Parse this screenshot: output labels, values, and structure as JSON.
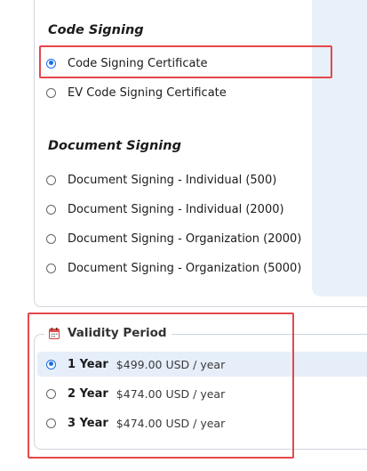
{
  "code_signing": {
    "title": "Code Signing",
    "options": [
      {
        "label": "Code Signing Certificate",
        "checked": true
      },
      {
        "label": "EV Code Signing Certificate",
        "checked": false
      }
    ]
  },
  "document_signing": {
    "title": "Document Signing",
    "options": [
      {
        "label": "Document Signing - Individual (500)",
        "checked": false
      },
      {
        "label": "Document Signing - Individual (2000)",
        "checked": false
      },
      {
        "label": "Document Signing - Organization (2000)",
        "checked": false
      },
      {
        "label": "Document Signing - Organization (5000)",
        "checked": false
      }
    ]
  },
  "validity": {
    "legend": "Validity Period",
    "icon": "calendar-icon",
    "options": [
      {
        "years": "1 Year",
        "price": "$499.00 USD / year",
        "checked": true
      },
      {
        "years": "2 Year",
        "price": "$474.00 USD / year",
        "checked": false
      },
      {
        "years": "3 Year",
        "price": "$474.00 USD / year",
        "checked": false
      }
    ]
  },
  "colors": {
    "accent": "#1a6fe6",
    "highlight_border": "#e5474b",
    "selected_row": "#e6eff9"
  }
}
